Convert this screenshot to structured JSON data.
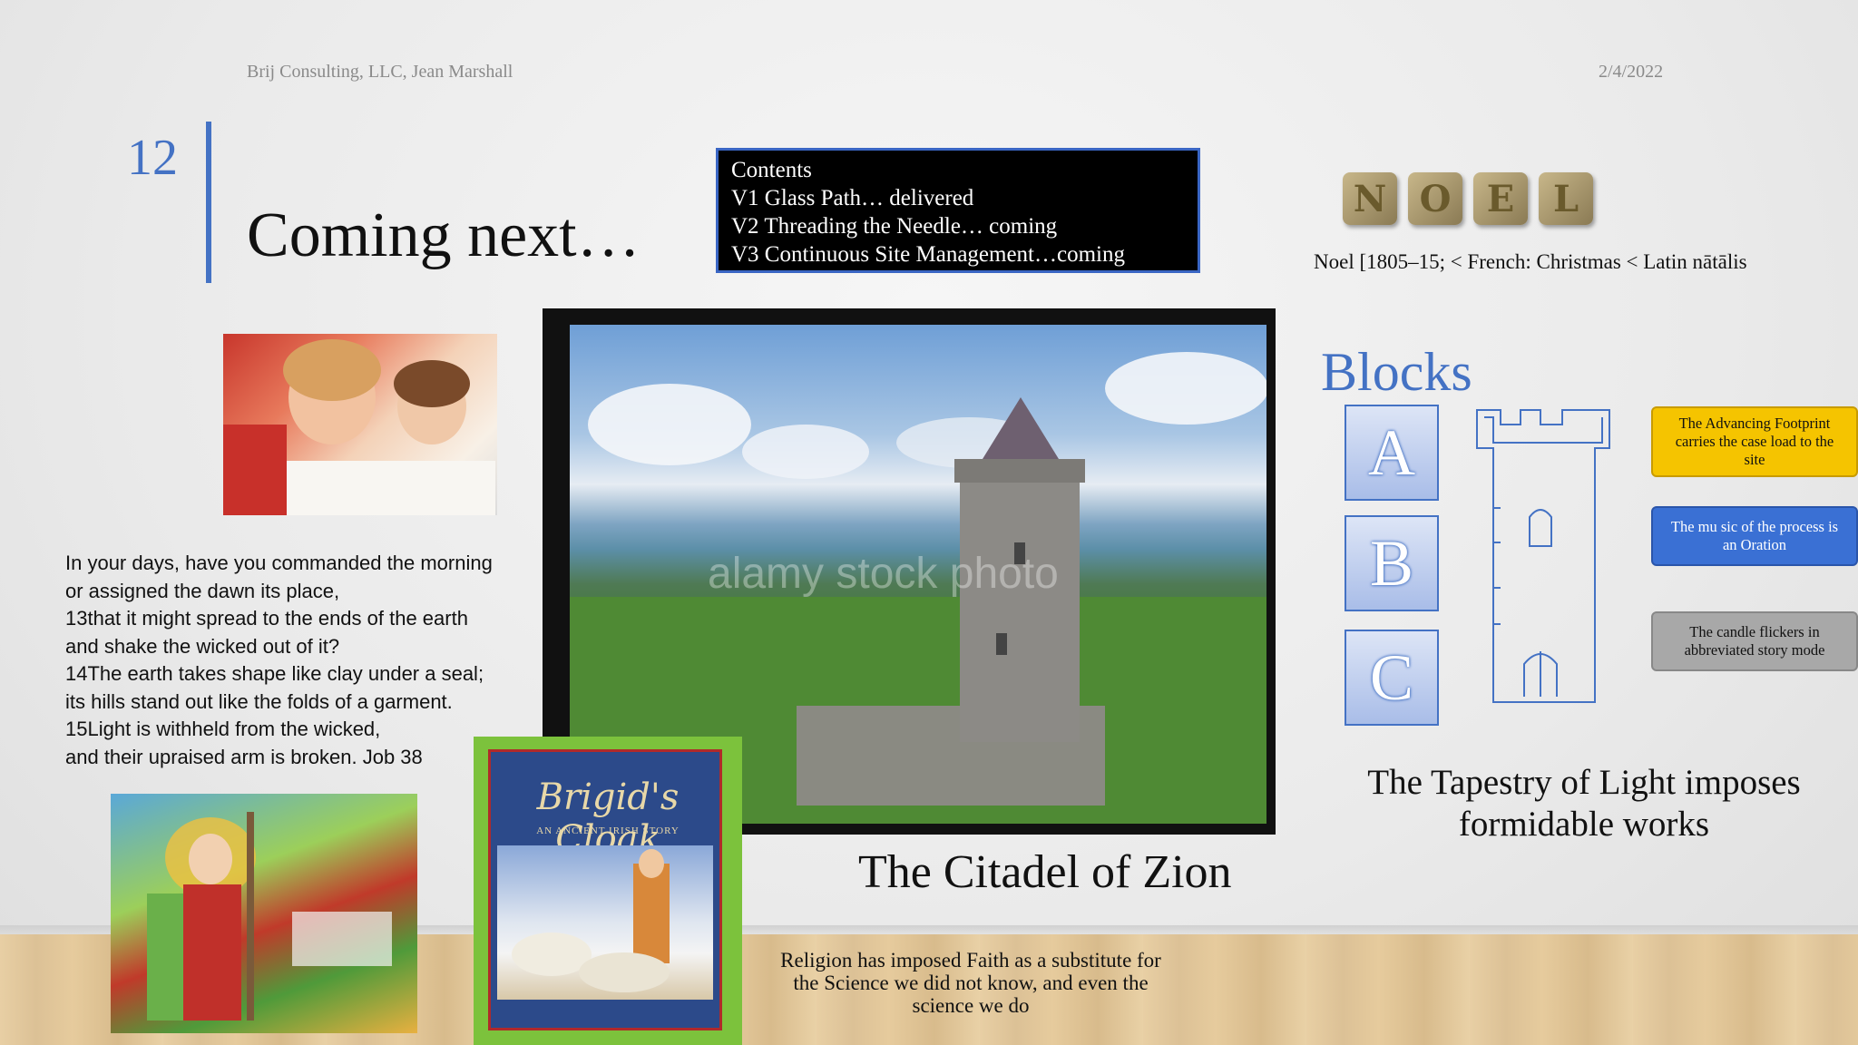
{
  "header": {
    "author": "Brij Consulting, LLC, Jean Marshall",
    "date": "2/4/2022"
  },
  "slide": {
    "number": "12",
    "title": "Coming next…"
  },
  "contents": {
    "lines": [
      "Contents",
      "V1 Glass Path… delivered",
      "V2 Threading the Needle… coming",
      "V3 Continuous Site Management…coming"
    ]
  },
  "noel": {
    "letters": [
      "N",
      "O",
      "E",
      "L"
    ],
    "definition": "Noel [1805–15; < French: Christmas < Latin nātālis"
  },
  "scripture": {
    "lines": [
      "In your days, have you commanded the morning",
      "or assigned the dawn its place,",
      "13that it might spread to the ends of the earth",
      "and shake the wicked out of it?",
      "14The earth takes shape like clay under a seal;",
      "its hills stand out like the folds of a garment.",
      "15Light is withheld from the wicked,",
      "and their upraised arm is broken. Job 38"
    ]
  },
  "castle": {
    "watermark": "alamy stock photo",
    "caption": "The Citadel of Zion"
  },
  "brigid_book": {
    "title": "Brigid's Cloak",
    "subtitle": "AN ANCIENT IRISH STORY"
  },
  "religion_text": "Religion has imposed Faith as a substitute for the Science we did not know, and even the science we do",
  "blocks": {
    "title": "Blocks",
    "items": [
      "A",
      "B",
      "C"
    ]
  },
  "scrolls": {
    "yellow": "The Advancing Footprint carries the case load to the site",
    "blue": "The mu sic of the process is an Oration",
    "gray": "The candle flickers in abbreviated story mode"
  },
  "tapestry": "The Tapestry of Light imposes formidable works",
  "colors": {
    "accent": "#4472c4",
    "scroll_yellow": "#f5c400",
    "scroll_blue": "#3a70d4",
    "scroll_gray": "#a8a8a8"
  }
}
